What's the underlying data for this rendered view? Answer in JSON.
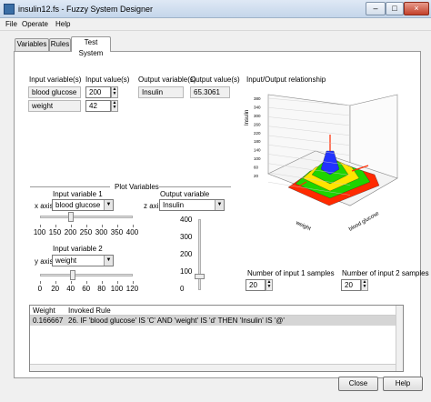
{
  "window": {
    "title": "insulin12.fs - Fuzzy System Designer",
    "minimize": "–",
    "maximize": "□",
    "close": "×"
  },
  "menu": {
    "items": [
      "File",
      "Operate",
      "Help"
    ]
  },
  "tabs": [
    {
      "label": "Variables",
      "active": false
    },
    {
      "label": "Rules",
      "active": false
    },
    {
      "label": "Test System",
      "active": true
    }
  ],
  "io": {
    "input_header": "Input variable(s)",
    "value_header": "Input value(s)",
    "output_header": "Output variable(s)",
    "output_value_header": "Output value(s)",
    "inputs": [
      {
        "name": "blood glucose",
        "value": "200"
      },
      {
        "name": "weight",
        "value": "42"
      }
    ],
    "outputs": [
      {
        "name": "Insulin",
        "value": "65.3061"
      }
    ]
  },
  "plot_vars": {
    "title": "Plot Variables",
    "input1_label": "Input variable 1",
    "x_axis_label": "x axis",
    "x_axis_value": "blood glucose",
    "x_slider_ticks": [
      "100",
      "150",
      "200",
      "250",
      "300",
      "350",
      "400"
    ],
    "x_slider_value": 200,
    "input2_label": "Input variable 2",
    "y_axis_label": "y axis",
    "y_axis_value": "weight",
    "y_slider_ticks": [
      "0",
      "20",
      "40",
      "60",
      "80",
      "100",
      "120"
    ],
    "y_slider_value": 42,
    "output_label": "Output variable",
    "z_axis_label": "z axis",
    "z_axis_value": "Insulin",
    "z_slider_ticks": [
      "400",
      "300",
      "200",
      "100",
      "0"
    ],
    "z_slider_value": 65.3061
  },
  "plot": {
    "title": "Input/Output relationship",
    "z_axis_title": "Insulin",
    "x_axis_title": "blood glucose",
    "y_axis_title": "weight",
    "z_ticks": [
      "380",
      "340",
      "300",
      "260",
      "220",
      "180",
      "140",
      "100",
      "60",
      "20"
    ],
    "colors": {
      "high": "#ff2a00",
      "mid": "#1fd400",
      "low": "#ffe400",
      "peak": "#2233ff"
    }
  },
  "samples": {
    "input1_label": "Number of input 1 samples",
    "input1_value": "20",
    "input2_label": "Number of input 2 samples",
    "input2_value": "20"
  },
  "rules_table": {
    "col_weight": "Weight",
    "col_rule": "Invoked Rule",
    "rows": [
      {
        "weight": "0.166667",
        "rule": "26. IF 'blood glucose' IS 'C' AND 'weight' IS 'd' THEN 'Insulin' IS '@'"
      }
    ]
  },
  "buttons": {
    "close": "Close",
    "help": "Help"
  }
}
